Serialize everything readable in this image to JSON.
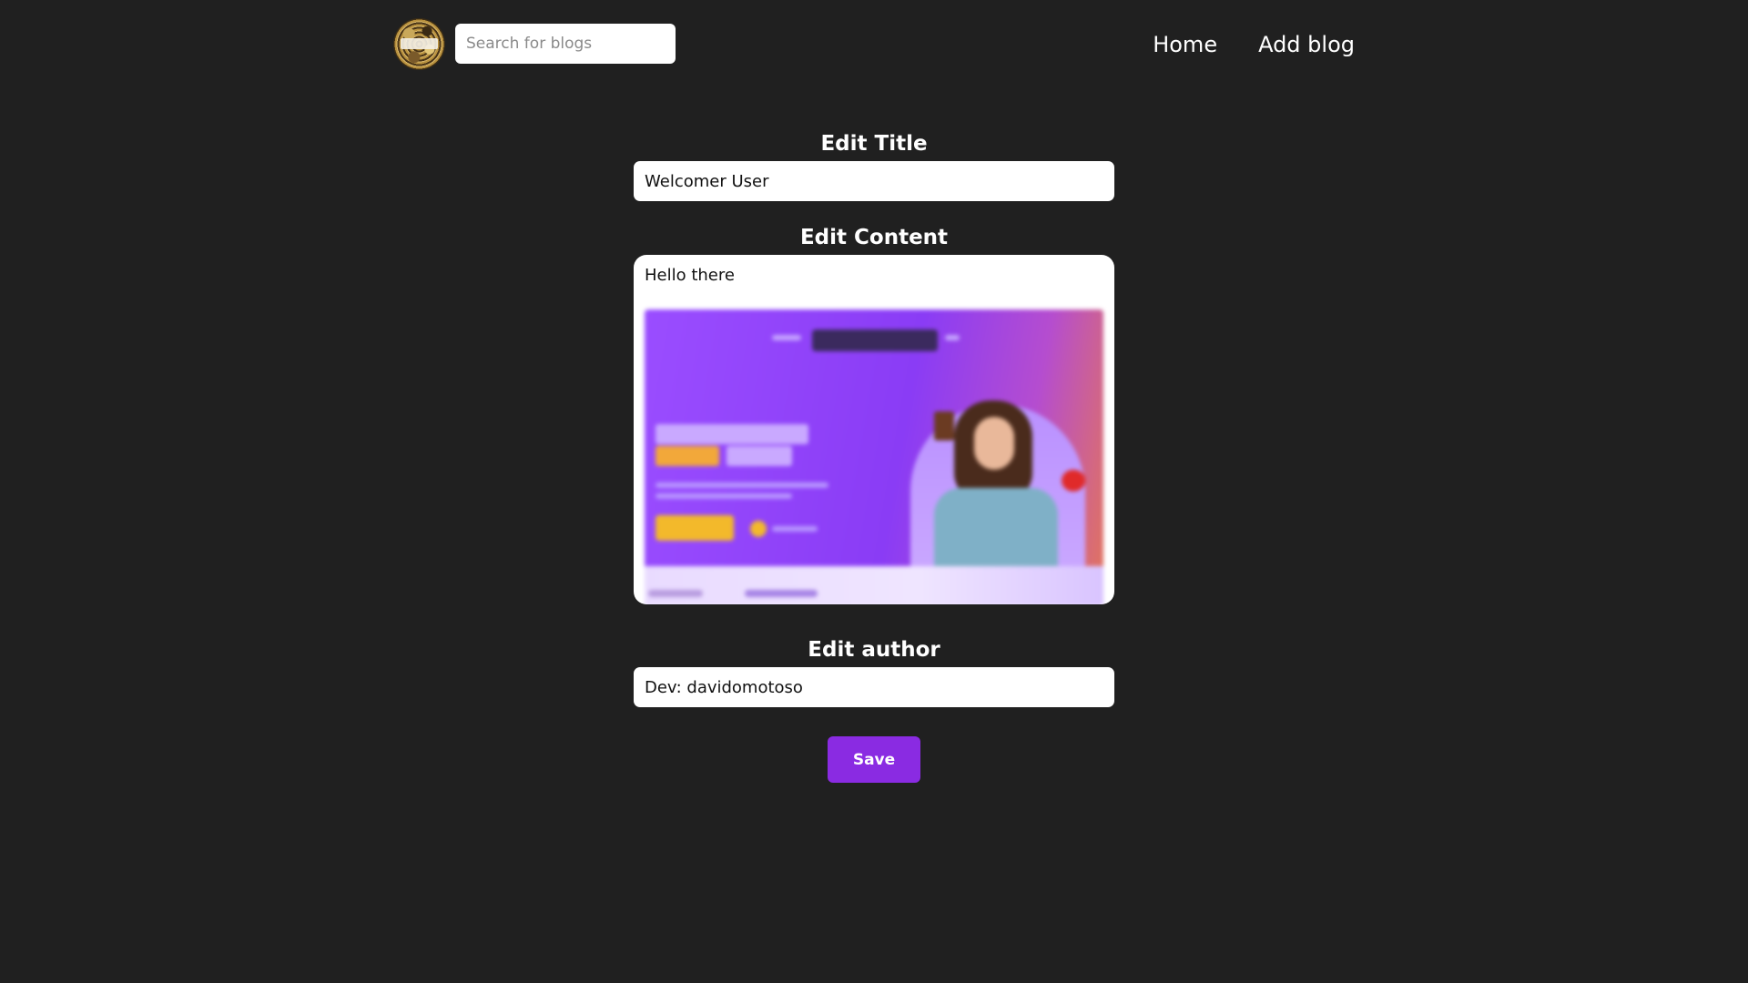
{
  "header": {
    "logo_icon": "blog-logo-icon",
    "search": {
      "placeholder": "Search for blogs",
      "value": ""
    },
    "nav": [
      {
        "label": "Home"
      },
      {
        "label": "Add blog"
      }
    ]
  },
  "form": {
    "title": {
      "label": "Edit Title",
      "value": "Welcomer User"
    },
    "content": {
      "label": "Edit Content",
      "text": "Hello there",
      "image": "blurred-promo-image"
    },
    "author": {
      "label": "Edit author",
      "value": "Dev: davidomotoso"
    },
    "save_label": "Save"
  },
  "colors": {
    "background": "#202020",
    "accent": "#8a2be2",
    "input_bg": "#ffffff",
    "text": "#ffffff"
  }
}
